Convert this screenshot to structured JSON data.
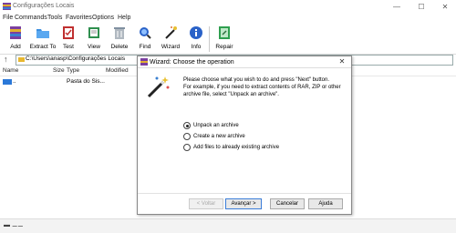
{
  "window": {
    "title": "Configurações Locais"
  },
  "menu": [
    "File",
    "Commands",
    "Tools",
    "Favorites",
    "Options",
    "Help"
  ],
  "toolbar": [
    {
      "label": "Add",
      "icon": "add-archive-icon"
    },
    {
      "label": "Extract To",
      "icon": "extract-folder-icon"
    },
    {
      "label": "Test",
      "icon": "test-icon"
    },
    {
      "label": "View",
      "icon": "view-book-icon"
    },
    {
      "label": "Delete",
      "icon": "trash-icon"
    },
    {
      "label": "Find",
      "icon": "find-magnifier-icon"
    },
    {
      "label": "Wizard",
      "icon": "wizard-wand-icon"
    },
    {
      "label": "Info",
      "icon": "info-icon"
    },
    {
      "label": "Repair",
      "icon": "repair-icon"
    }
  ],
  "address": {
    "path": "C:\\Users\\anasp\\Configurações Locais"
  },
  "columns": [
    "Name",
    "Size",
    "Type",
    "Modified"
  ],
  "rows": [
    {
      "name": "..",
      "type": "Pasta do Sis..."
    }
  ],
  "dialog": {
    "title": "Wizard:  Choose the operation",
    "intro": [
      "Please choose what you wish to do and press \"Next\" button.",
      "For example, if you need to extract contents of RAR, ZIP or other",
      "archive file, select \"Unpack an archive\"."
    ],
    "options": [
      {
        "label": "Unpack an archive",
        "selected": true
      },
      {
        "label": "Create a new archive",
        "selected": false
      },
      {
        "label": "Add files to already existing archive",
        "selected": false
      }
    ],
    "buttons": {
      "back": "< Voltar",
      "next": "Avançar >",
      "cancel": "Cancelar",
      "help": "Ajuda"
    }
  },
  "colors": {
    "accent": "#3b7dd8",
    "folder": "#2b78d8"
  }
}
